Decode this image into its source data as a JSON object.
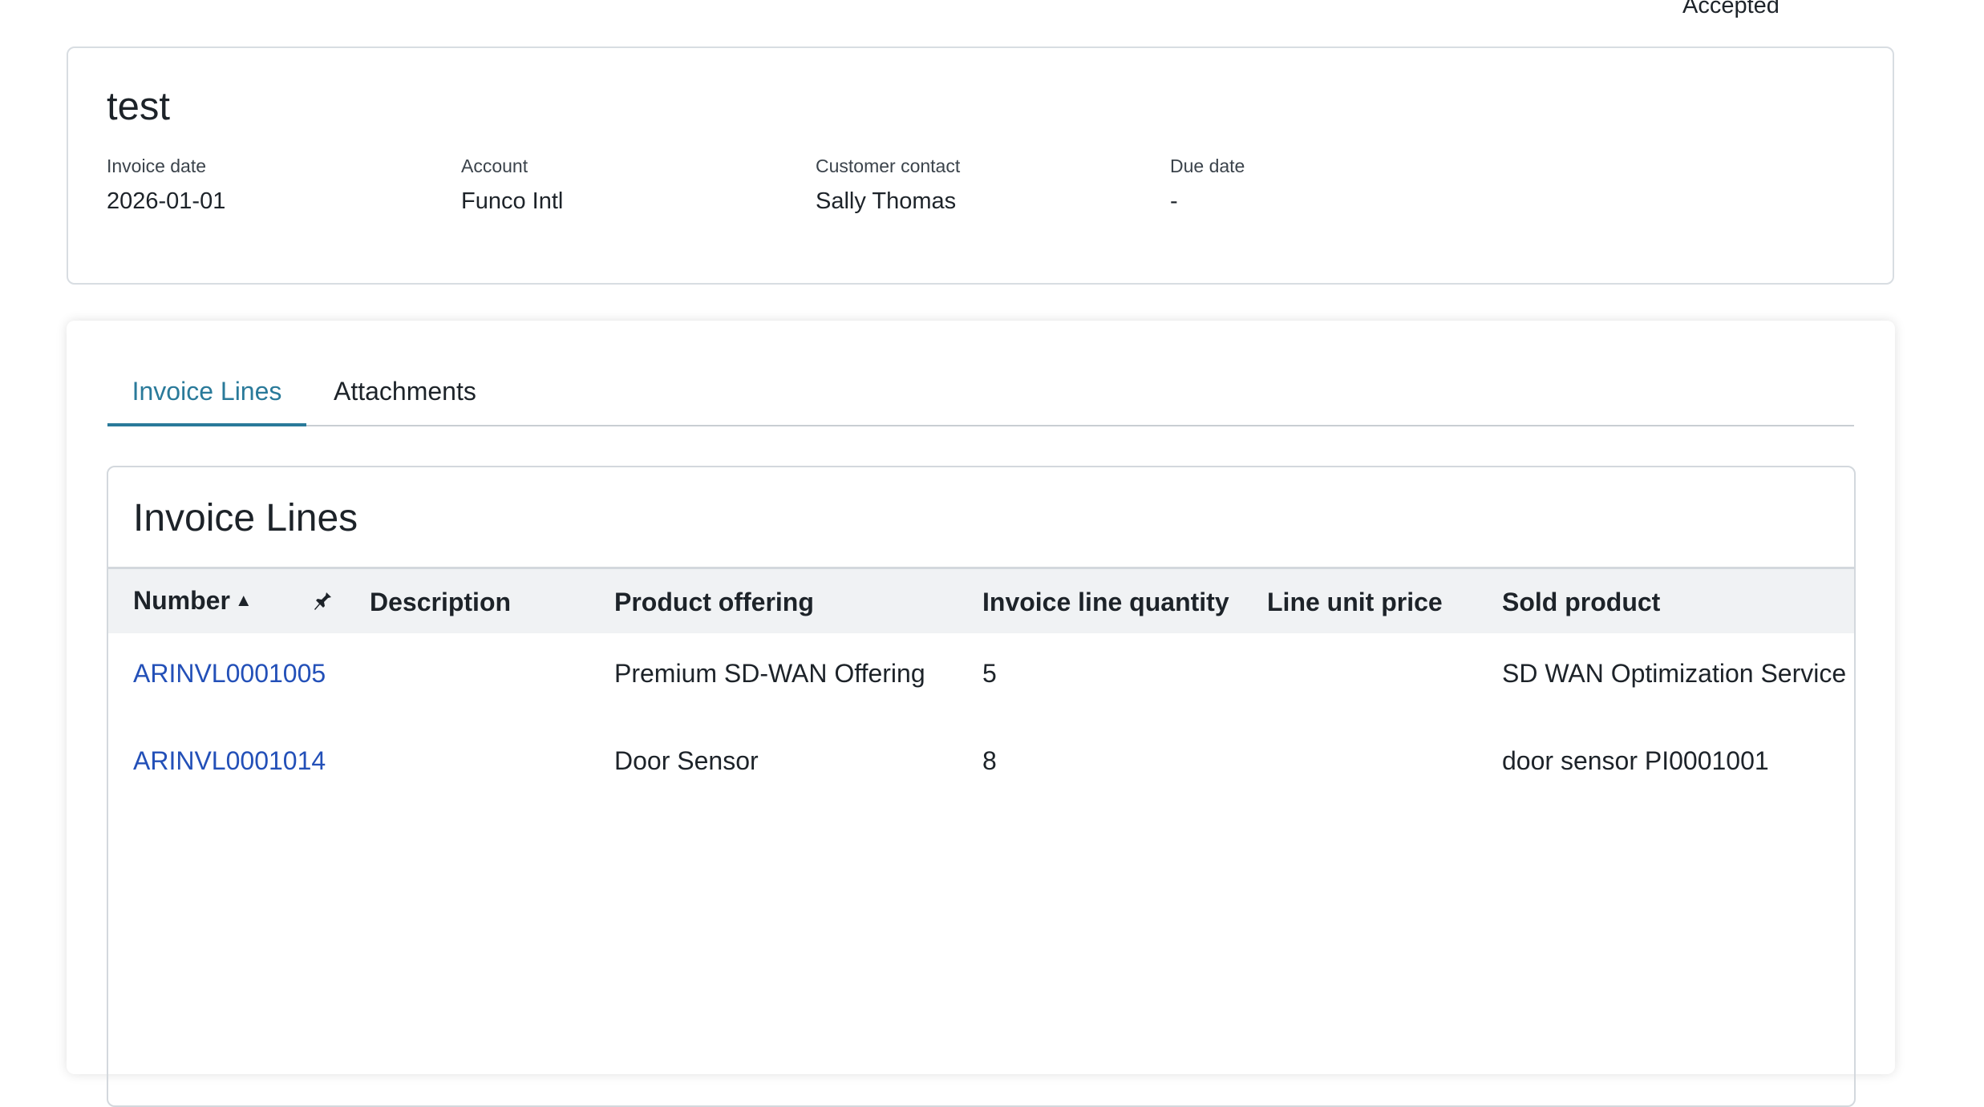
{
  "record": {
    "status": "Accepted",
    "title": "test",
    "fields": [
      {
        "label": "Invoice date",
        "value": "2026-01-01"
      },
      {
        "label": "Account",
        "value": "Funco Intl"
      },
      {
        "label": "Customer contact",
        "value": "Sally Thomas"
      },
      {
        "label": "Due date",
        "value": "-"
      }
    ]
  },
  "tabs": [
    {
      "label": "Invoice Lines",
      "active": true
    },
    {
      "label": "Attachments",
      "active": false
    }
  ],
  "list": {
    "title": "Invoice Lines",
    "columns": [
      {
        "label": "Number",
        "sort": "ascending",
        "sort_icon": "sort-ascending-icon"
      },
      {
        "label": "Description"
      },
      {
        "label": "Product offering"
      },
      {
        "label": "Invoice line quantity"
      },
      {
        "label": "Line unit price"
      },
      {
        "label": "Sold product"
      }
    ],
    "pin_icon": "pin-icon",
    "rows": [
      {
        "number": "ARINVL0001005",
        "description": "",
        "product_offering": "Premium SD-WAN Offering",
        "quantity": "5",
        "unit_price": "",
        "sold_product": "SD WAN Optimization Service P"
      },
      {
        "number": "ARINVL0001014",
        "description": "",
        "product_offering": "Door Sensor",
        "quantity": "8",
        "unit_price": "",
        "sold_product": "door sensor PI0001001"
      }
    ]
  },
  "colors": {
    "tab_active": "#2a7a9a",
    "link": "#2350b8",
    "header_bg": "#f0f2f4",
    "text": "#1d2329"
  }
}
